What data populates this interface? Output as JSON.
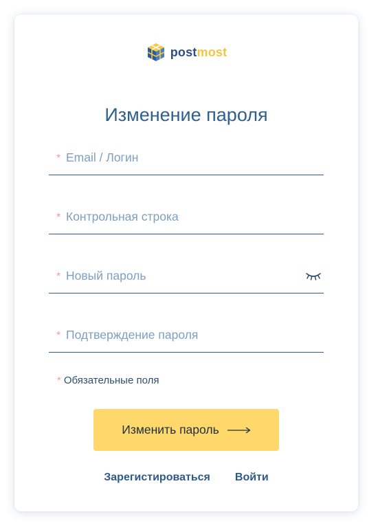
{
  "logo": {
    "part1": "post",
    "part2": "most"
  },
  "form": {
    "title": "Изменение пароля",
    "required_mark": "*",
    "fields": {
      "email": {
        "placeholder": "Email / Логин",
        "value": ""
      },
      "control": {
        "placeholder": "Контрольная строка",
        "value": ""
      },
      "new_password": {
        "placeholder": "Новый пароль",
        "value": "",
        "icon": "eye-closed-icon"
      },
      "confirm": {
        "placeholder": "Подтверждение пароля",
        "value": ""
      }
    },
    "required_note": "Обязательные поля",
    "submit_label": "Изменить пароль",
    "submit_icon": "arrow-right-icon"
  },
  "links": {
    "register": "Зарегистироваться",
    "login": "Войти"
  },
  "colors": {
    "title": "#2e5f8e",
    "accent_button": "#fed86b",
    "required_star": "#f19aa7",
    "logo_blue": "#2b4e8a",
    "logo_yellow": "#f2c744"
  }
}
